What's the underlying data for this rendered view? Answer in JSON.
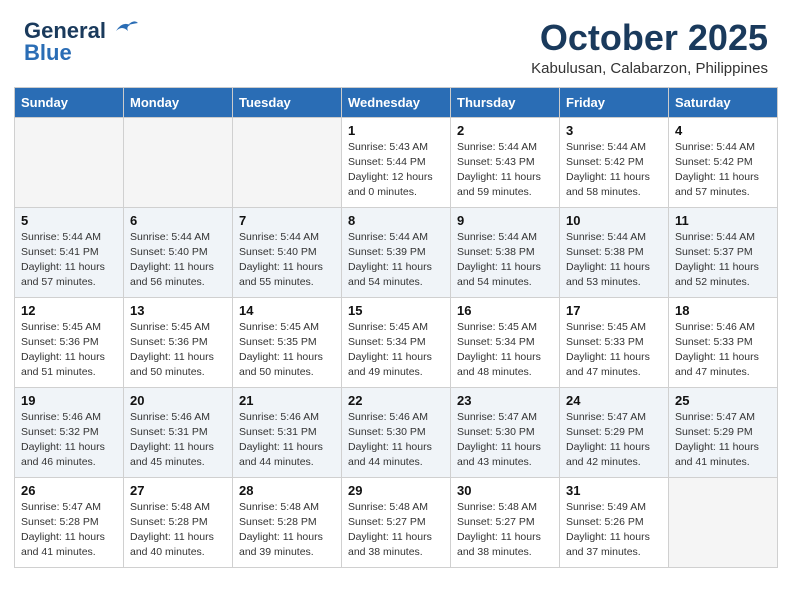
{
  "header": {
    "logo_general": "General",
    "logo_blue": "Blue",
    "month": "October 2025",
    "location": "Kabulusan, Calabarzon, Philippines"
  },
  "days_of_week": [
    "Sunday",
    "Monday",
    "Tuesday",
    "Wednesday",
    "Thursday",
    "Friday",
    "Saturday"
  ],
  "weeks": [
    [
      {
        "day": "",
        "info": ""
      },
      {
        "day": "",
        "info": ""
      },
      {
        "day": "",
        "info": ""
      },
      {
        "day": "1",
        "info": "Sunrise: 5:43 AM\nSunset: 5:44 PM\nDaylight: 12 hours\nand 0 minutes."
      },
      {
        "day": "2",
        "info": "Sunrise: 5:44 AM\nSunset: 5:43 PM\nDaylight: 11 hours\nand 59 minutes."
      },
      {
        "day": "3",
        "info": "Sunrise: 5:44 AM\nSunset: 5:42 PM\nDaylight: 11 hours\nand 58 minutes."
      },
      {
        "day": "4",
        "info": "Sunrise: 5:44 AM\nSunset: 5:42 PM\nDaylight: 11 hours\nand 57 minutes."
      }
    ],
    [
      {
        "day": "5",
        "info": "Sunrise: 5:44 AM\nSunset: 5:41 PM\nDaylight: 11 hours\nand 57 minutes."
      },
      {
        "day": "6",
        "info": "Sunrise: 5:44 AM\nSunset: 5:40 PM\nDaylight: 11 hours\nand 56 minutes."
      },
      {
        "day": "7",
        "info": "Sunrise: 5:44 AM\nSunset: 5:40 PM\nDaylight: 11 hours\nand 55 minutes."
      },
      {
        "day": "8",
        "info": "Sunrise: 5:44 AM\nSunset: 5:39 PM\nDaylight: 11 hours\nand 54 minutes."
      },
      {
        "day": "9",
        "info": "Sunrise: 5:44 AM\nSunset: 5:38 PM\nDaylight: 11 hours\nand 54 minutes."
      },
      {
        "day": "10",
        "info": "Sunrise: 5:44 AM\nSunset: 5:38 PM\nDaylight: 11 hours\nand 53 minutes."
      },
      {
        "day": "11",
        "info": "Sunrise: 5:44 AM\nSunset: 5:37 PM\nDaylight: 11 hours\nand 52 minutes."
      }
    ],
    [
      {
        "day": "12",
        "info": "Sunrise: 5:45 AM\nSunset: 5:36 PM\nDaylight: 11 hours\nand 51 minutes."
      },
      {
        "day": "13",
        "info": "Sunrise: 5:45 AM\nSunset: 5:36 PM\nDaylight: 11 hours\nand 50 minutes."
      },
      {
        "day": "14",
        "info": "Sunrise: 5:45 AM\nSunset: 5:35 PM\nDaylight: 11 hours\nand 50 minutes."
      },
      {
        "day": "15",
        "info": "Sunrise: 5:45 AM\nSunset: 5:34 PM\nDaylight: 11 hours\nand 49 minutes."
      },
      {
        "day": "16",
        "info": "Sunrise: 5:45 AM\nSunset: 5:34 PM\nDaylight: 11 hours\nand 48 minutes."
      },
      {
        "day": "17",
        "info": "Sunrise: 5:45 AM\nSunset: 5:33 PM\nDaylight: 11 hours\nand 47 minutes."
      },
      {
        "day": "18",
        "info": "Sunrise: 5:46 AM\nSunset: 5:33 PM\nDaylight: 11 hours\nand 47 minutes."
      }
    ],
    [
      {
        "day": "19",
        "info": "Sunrise: 5:46 AM\nSunset: 5:32 PM\nDaylight: 11 hours\nand 46 minutes."
      },
      {
        "day": "20",
        "info": "Sunrise: 5:46 AM\nSunset: 5:31 PM\nDaylight: 11 hours\nand 45 minutes."
      },
      {
        "day": "21",
        "info": "Sunrise: 5:46 AM\nSunset: 5:31 PM\nDaylight: 11 hours\nand 44 minutes."
      },
      {
        "day": "22",
        "info": "Sunrise: 5:46 AM\nSunset: 5:30 PM\nDaylight: 11 hours\nand 44 minutes."
      },
      {
        "day": "23",
        "info": "Sunrise: 5:47 AM\nSunset: 5:30 PM\nDaylight: 11 hours\nand 43 minutes."
      },
      {
        "day": "24",
        "info": "Sunrise: 5:47 AM\nSunset: 5:29 PM\nDaylight: 11 hours\nand 42 minutes."
      },
      {
        "day": "25",
        "info": "Sunrise: 5:47 AM\nSunset: 5:29 PM\nDaylight: 11 hours\nand 41 minutes."
      }
    ],
    [
      {
        "day": "26",
        "info": "Sunrise: 5:47 AM\nSunset: 5:28 PM\nDaylight: 11 hours\nand 41 minutes."
      },
      {
        "day": "27",
        "info": "Sunrise: 5:48 AM\nSunset: 5:28 PM\nDaylight: 11 hours\nand 40 minutes."
      },
      {
        "day": "28",
        "info": "Sunrise: 5:48 AM\nSunset: 5:28 PM\nDaylight: 11 hours\nand 39 minutes."
      },
      {
        "day": "29",
        "info": "Sunrise: 5:48 AM\nSunset: 5:27 PM\nDaylight: 11 hours\nand 38 minutes."
      },
      {
        "day": "30",
        "info": "Sunrise: 5:48 AM\nSunset: 5:27 PM\nDaylight: 11 hours\nand 38 minutes."
      },
      {
        "day": "31",
        "info": "Sunrise: 5:49 AM\nSunset: 5:26 PM\nDaylight: 11 hours\nand 37 minutes."
      },
      {
        "day": "",
        "info": ""
      }
    ]
  ]
}
